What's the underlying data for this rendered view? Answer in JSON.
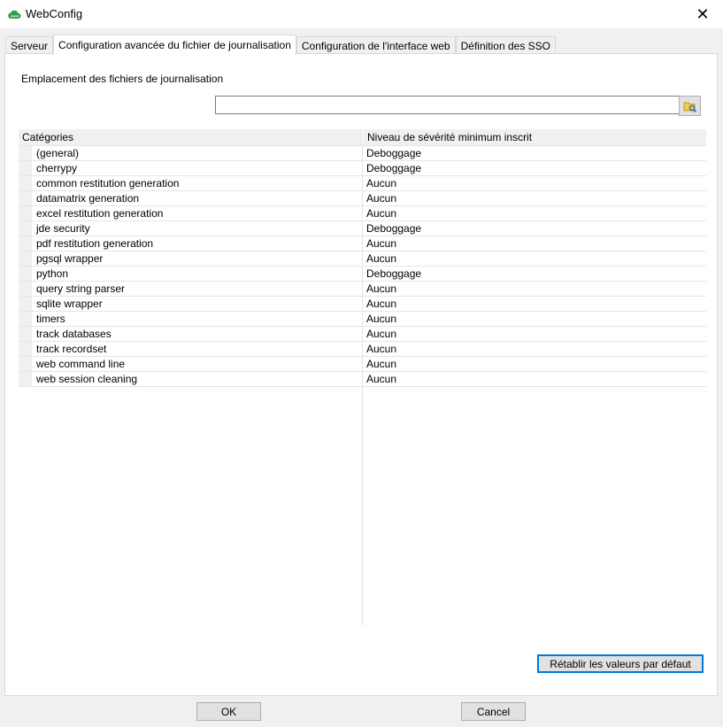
{
  "window": {
    "title": "WebConfig",
    "close_glyph": "✕",
    "app_icon": "cloud-icon"
  },
  "tabs": [
    {
      "label": "Serveur",
      "active": false
    },
    {
      "label": "Configuration avancée du fichier de journalisation",
      "active": true
    },
    {
      "label": "Configuration de l'interface web",
      "active": false
    },
    {
      "label": "Définition des SSO",
      "active": false
    }
  ],
  "log_location": {
    "label": "Emplacement des fichiers de journalisation",
    "value": "",
    "placeholder": "",
    "browse_icon": "folder-browse-icon"
  },
  "grid": {
    "headers": [
      "Catégories",
      "Niveau de sévérité minimum inscrit"
    ],
    "rows": [
      {
        "category": "(general)",
        "level": "Deboggage"
      },
      {
        "category": "cherrypy",
        "level": "Deboggage"
      },
      {
        "category": "common restitution generation",
        "level": "Aucun"
      },
      {
        "category": "datamatrix generation",
        "level": "Aucun"
      },
      {
        "category": "excel restitution generation",
        "level": "Aucun"
      },
      {
        "category": "jde security",
        "level": "Deboggage"
      },
      {
        "category": "pdf restitution generation",
        "level": "Aucun"
      },
      {
        "category": "pgsql wrapper",
        "level": "Aucun"
      },
      {
        "category": "python",
        "level": "Deboggage"
      },
      {
        "category": "query string parser",
        "level": "Aucun"
      },
      {
        "category": "sqlite wrapper",
        "level": "Aucun"
      },
      {
        "category": "timers",
        "level": "Aucun"
      },
      {
        "category": "track databases",
        "level": "Aucun"
      },
      {
        "category": "track recordset",
        "level": "Aucun"
      },
      {
        "category": "web command line",
        "level": "Aucun"
      },
      {
        "category": "web session cleaning",
        "level": "Aucun"
      }
    ]
  },
  "buttons": {
    "reset": "Rétablir les valeurs par défaut",
    "ok": "OK",
    "cancel": "Cancel"
  },
  "colors": {
    "accent": "#0078d7",
    "cloud_icon": "#2e9e4f"
  }
}
